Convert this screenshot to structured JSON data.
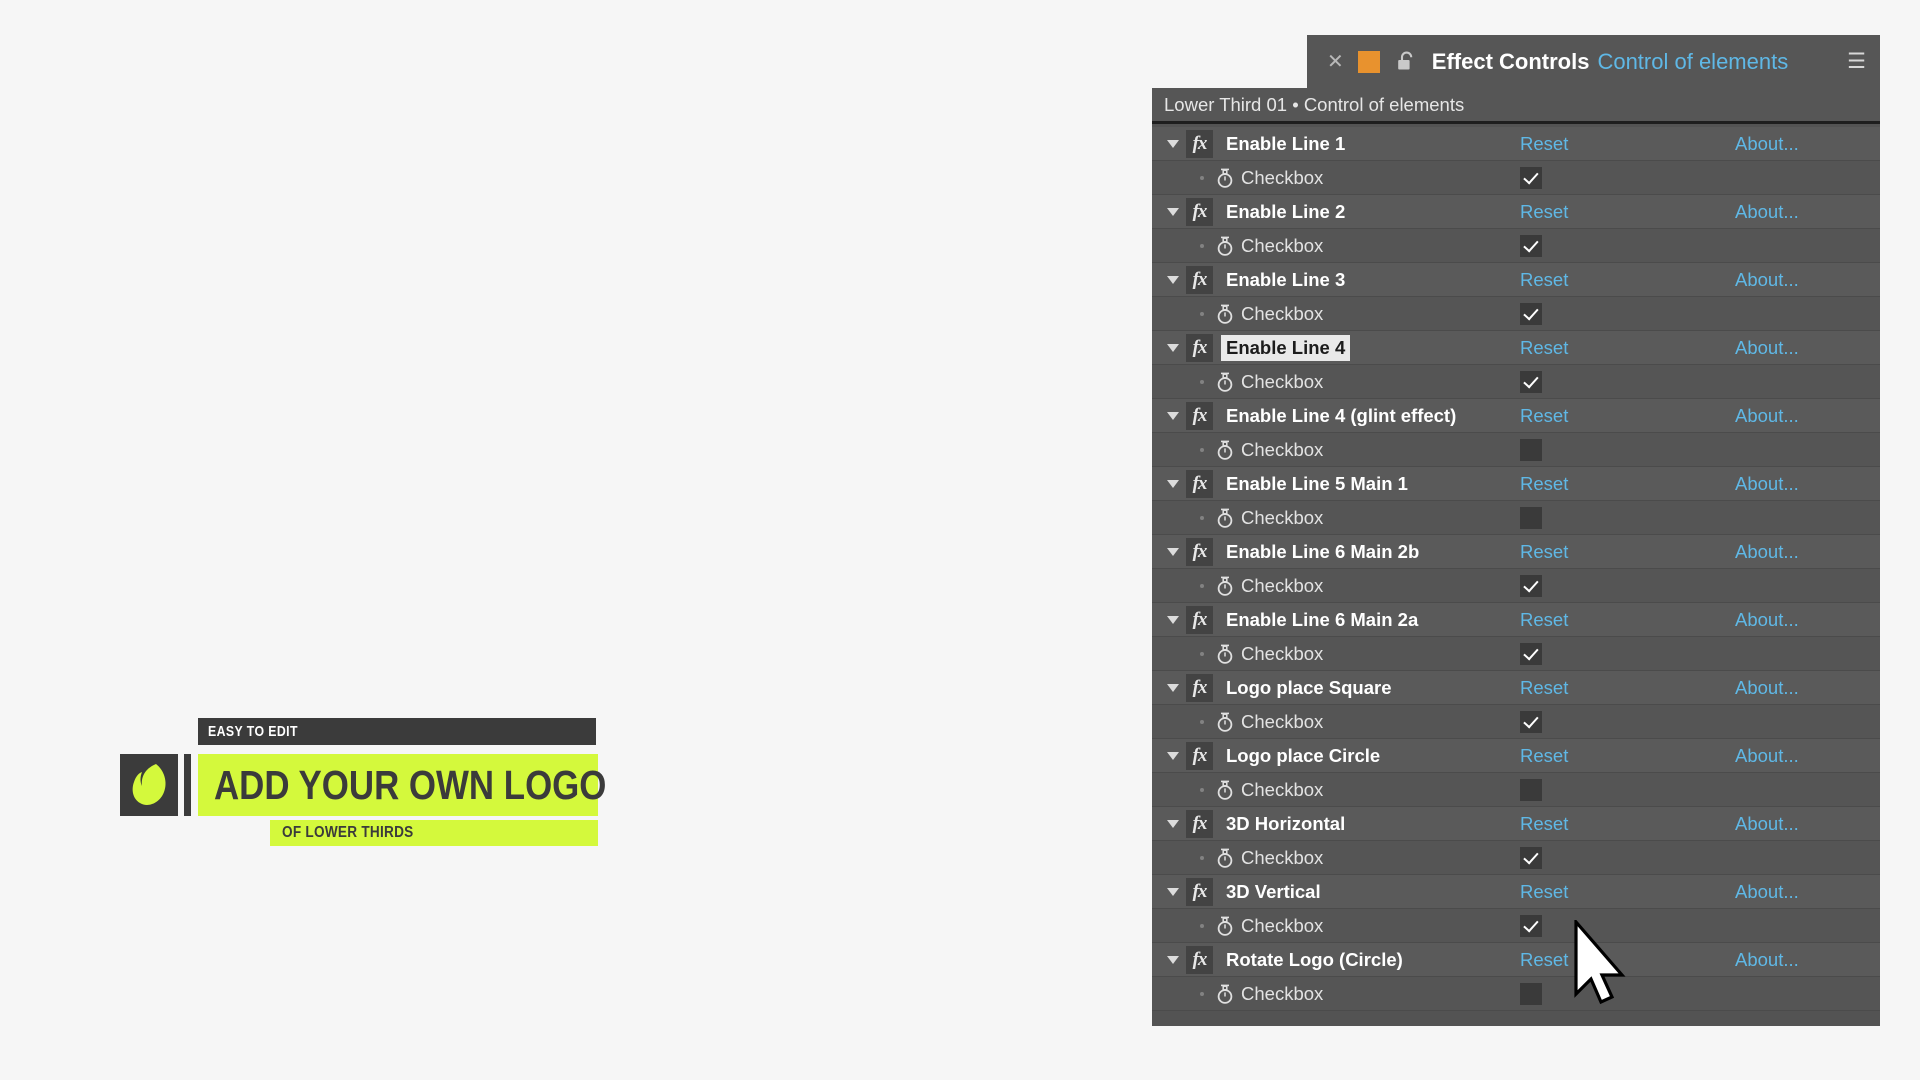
{
  "titlebar": {
    "close_icon": "close-icon",
    "swatch_color": "#e8922e",
    "lock_icon": "unlocked-lock-icon",
    "title": "Effect Controls",
    "subtitle": "Control of elements",
    "menu_icon": "hamburger-menu-icon"
  },
  "breadcrumb": {
    "text": "Lower Third 01 • Control of elements"
  },
  "columns": {
    "reset_label": "Reset",
    "about_label": "About...",
    "property_label": "Checkbox"
  },
  "effects": [
    {
      "name": "Enable Line 1",
      "reset": "Reset",
      "about": "About...",
      "highlighted": false,
      "property": {
        "label": "Checkbox",
        "checked": true
      }
    },
    {
      "name": "Enable Line 2",
      "reset": "Reset",
      "about": "About...",
      "highlighted": false,
      "property": {
        "label": "Checkbox",
        "checked": true
      }
    },
    {
      "name": "Enable Line 3",
      "reset": "Reset",
      "about": "About...",
      "highlighted": false,
      "property": {
        "label": "Checkbox",
        "checked": true
      }
    },
    {
      "name": "Enable Line 4",
      "reset": "Reset",
      "about": "About...",
      "highlighted": true,
      "property": {
        "label": "Checkbox",
        "checked": true
      }
    },
    {
      "name": "Enable Line 4 (glint effect)",
      "reset": "Reset",
      "about": "About...",
      "highlighted": false,
      "property": {
        "label": "Checkbox",
        "checked": false
      }
    },
    {
      "name": "Enable Line 5 Main 1",
      "reset": "Reset",
      "about": "About...",
      "highlighted": false,
      "property": {
        "label": "Checkbox",
        "checked": false
      }
    },
    {
      "name": "Enable Line 6 Main 2b",
      "reset": "Reset",
      "about": "About...",
      "highlighted": false,
      "property": {
        "label": "Checkbox",
        "checked": true
      }
    },
    {
      "name": "Enable Line 6 Main 2a",
      "reset": "Reset",
      "about": "About...",
      "highlighted": false,
      "property": {
        "label": "Checkbox",
        "checked": true
      }
    },
    {
      "name": "Logo place Square",
      "reset": "Reset",
      "about": "About...",
      "highlighted": false,
      "property": {
        "label": "Checkbox",
        "checked": true
      }
    },
    {
      "name": "Logo place Circle",
      "reset": "Reset",
      "about": "About...",
      "highlighted": false,
      "property": {
        "label": "Checkbox",
        "checked": false
      }
    },
    {
      "name": "3D Horizontal",
      "reset": "Reset",
      "about": "About...",
      "highlighted": false,
      "property": {
        "label": "Checkbox",
        "checked": true
      }
    },
    {
      "name": "3D Vertical",
      "reset": "Reset",
      "about": "About...",
      "highlighted": false,
      "property": {
        "label": "Checkbox",
        "checked": true
      }
    },
    {
      "name": "Rotate Logo (Circle)",
      "reset": "Reset",
      "about": "About...",
      "highlighted": false,
      "property": {
        "label": "Checkbox",
        "checked": false
      }
    }
  ],
  "lower_third": {
    "top_text": "EASY TO EDIT",
    "main_text": "ADD YOUR OWN LOGO",
    "sub_text": "OF LOWER THIRDS",
    "accent_color": "#d4f93c",
    "dark_color": "#3b3b3b",
    "logo_icon": "leaf-logo-icon"
  }
}
